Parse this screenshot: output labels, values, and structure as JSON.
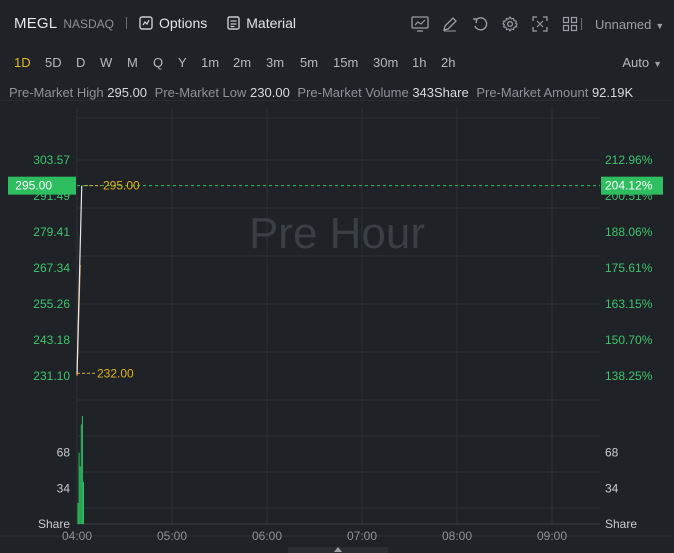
{
  "header": {
    "ticker": "MEGL",
    "exchange": "NASDAQ",
    "options_label": "Options",
    "material_label": "Material",
    "layout_name": "Unnamed",
    "icons": [
      "chart-icon",
      "draw-icon",
      "undo-icon",
      "gear-icon",
      "fullscreen-icon",
      "grid-icon"
    ]
  },
  "timeframes": [
    "1D",
    "5D",
    "D",
    "W",
    "M",
    "Q",
    "Y",
    "1m",
    "2m",
    "3m",
    "5m",
    "15m",
    "30m",
    "1h",
    "2h"
  ],
  "active_timeframe": "1D",
  "auto_label": "Auto",
  "stats": [
    {
      "label": "Pre-Market High",
      "value": "295.00"
    },
    {
      "label": "Pre-Market Low",
      "value": "230.00"
    },
    {
      "label": "Pre-Market Volume",
      "value": "343Share"
    },
    {
      "label": "Pre-Market Amount",
      "value": "92.19K"
    }
  ],
  "colors": {
    "background": "#1f2226",
    "grid": "#2c3036",
    "price_axis_text": "#3ec46d",
    "current_price_bg": "#2ebd5f",
    "dashed_marker": "#e0b21a",
    "volume": "#2ebd5f",
    "line_white": "#e6e6e6",
    "line_orange": "#f0953a",
    "watermark": "#3a3e45"
  },
  "chart_data": {
    "type": "line",
    "watermark": "Pre Hour",
    "x_ticks": [
      "04:00",
      "05:00",
      "06:00",
      "07:00",
      "08:00",
      "09:00"
    ],
    "y_left_ticks": [
      "303.57",
      "291.49",
      "279.41",
      "267.34",
      "255.26",
      "243.18",
      "231.10"
    ],
    "y_right_ticks": [
      "212.96%",
      "200.51%",
      "188.06%",
      "175.61%",
      "163.15%",
      "150.70%",
      "138.25%"
    ],
    "current_price_left": "295.00",
    "current_price_right": "204.12%",
    "high_marker": "295.00",
    "low_marker": "232.00",
    "price_range": [
      231.1,
      303.57
    ],
    "series": [
      {
        "color": "line_orange",
        "x": [
          "04:00",
          "04:02"
        ],
        "values": [
          231.5,
          268.5
        ]
      },
      {
        "color": "line_white",
        "x": [
          "04:00",
          "04:03"
        ],
        "values": [
          232.0,
          295.0
        ]
      }
    ],
    "volume": {
      "unit": "Share",
      "ticks": [
        "68",
        "34"
      ],
      "range": [
        0,
        102
      ],
      "bars": [
        20,
        68,
        55,
        95,
        103,
        40
      ]
    }
  }
}
